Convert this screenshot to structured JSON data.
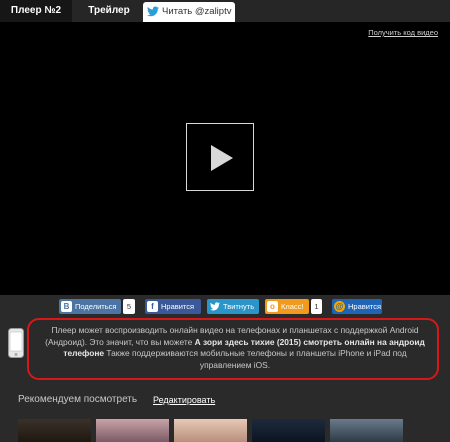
{
  "tabs": {
    "player2": "Плеер №2",
    "trailer": "Трейлер",
    "twitter": "Читать @zaliptv"
  },
  "player": {
    "embed_link": "Получить код видео",
    "play_icon": "play-icon"
  },
  "share": {
    "vk": {
      "icon": "В",
      "label": "Поделиться",
      "count": "5"
    },
    "fb": {
      "icon": "f",
      "label": "Нравится"
    },
    "tw": {
      "label": "Твитнуть"
    },
    "ok": {
      "icon": "о",
      "label": "Класс!",
      "count": "1"
    },
    "mail": {
      "icon": "@",
      "label": "Нравится"
    }
  },
  "notice": {
    "text_before": "Плеер может воспроизводить онлайн видео на телефонах и планшетах с поддержкой Android (Андроид). Это значит, что вы можете ",
    "text_bold": "А зори здесь тихие (2015) смотреть онлайн на андроид телефоне",
    "text_after": " Также поддерживаются мобильные телефоны и планшеты iPhone и iPad под управлением iOS.",
    "phone_icon": "phone-icon"
  },
  "recommend": {
    "title": "Рекомендуем посмотреть",
    "edit": "Редактировать"
  },
  "colors": {
    "background": "#2a2a2a",
    "player": "#000000",
    "notice_border": "#d61818",
    "vk": "#4c75a3",
    "fb": "#3b5998",
    "tw": "#2a95c9",
    "ok": "#f29a1c",
    "mail": "#1f65b7"
  }
}
